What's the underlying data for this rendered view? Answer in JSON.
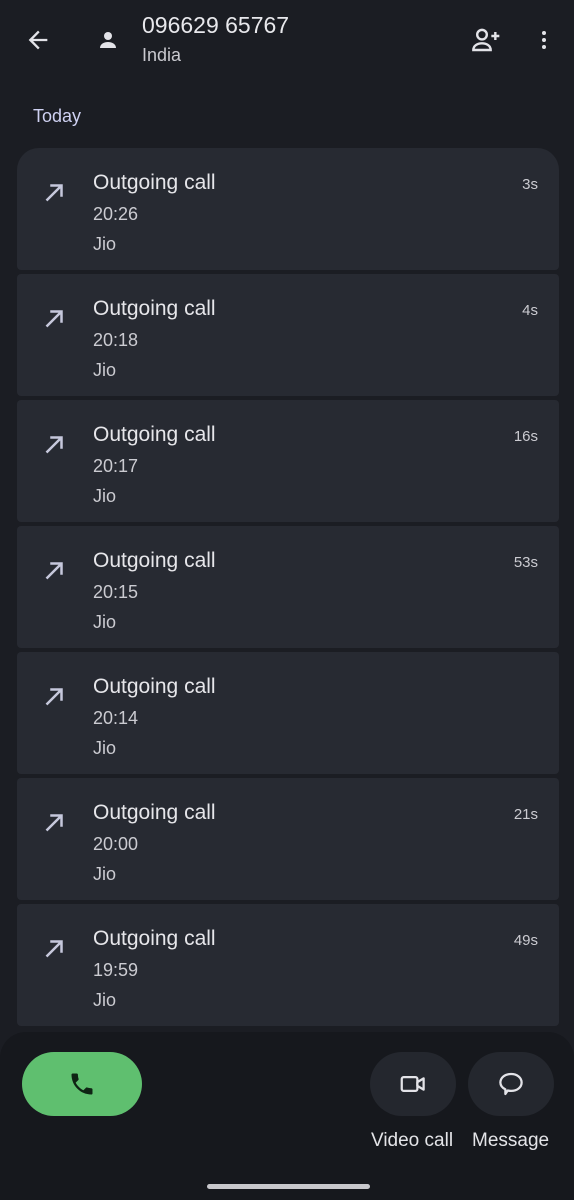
{
  "header": {
    "contact_number": "096629 65767",
    "region": "India",
    "icons": {
      "back": "back-arrow-icon",
      "avatar": "person-icon",
      "add_contact": "add-person-icon",
      "more": "more-vert-icon"
    }
  },
  "section": {
    "title": "Today"
  },
  "calls": [
    {
      "type": "Outgoing call",
      "time": "20:26",
      "carrier": "Jio",
      "duration": "3s"
    },
    {
      "type": "Outgoing call",
      "time": "20:18",
      "carrier": "Jio",
      "duration": "4s"
    },
    {
      "type": "Outgoing call",
      "time": "20:17",
      "carrier": "Jio",
      "duration": "16s"
    },
    {
      "type": "Outgoing call",
      "time": "20:15",
      "carrier": "Jio",
      "duration": "53s"
    },
    {
      "type": "Outgoing call",
      "time": "20:14",
      "carrier": "Jio",
      "duration": ""
    },
    {
      "type": "Outgoing call",
      "time": "20:00",
      "carrier": "Jio",
      "duration": "21s"
    },
    {
      "type": "Outgoing call",
      "time": "19:59",
      "carrier": "Jio",
      "duration": "49s"
    }
  ],
  "actions": {
    "video_call_label": "Video call",
    "message_label": "Message"
  },
  "colors": {
    "background": "#1b1d23",
    "card": "#272a32",
    "call_button": "#5fbf6f",
    "accent_text": "#cfd1f2"
  }
}
